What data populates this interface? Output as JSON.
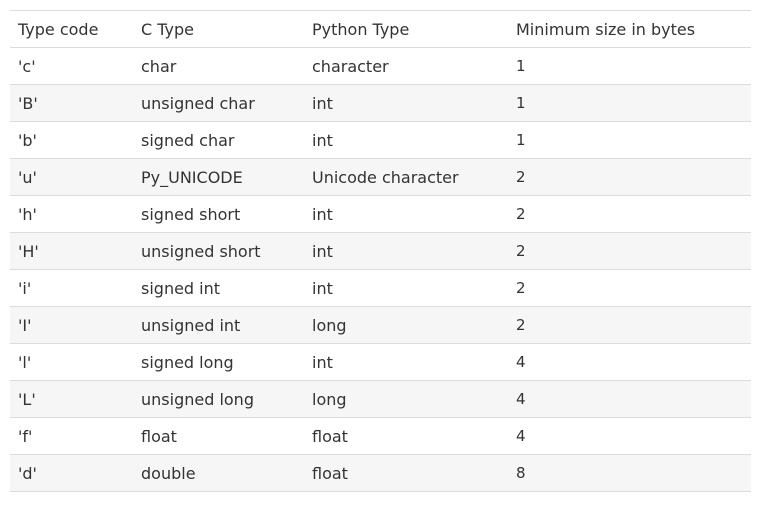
{
  "table": {
    "headers": [
      "Type code",
      "C Type",
      "Python Type",
      "Minimum size in bytes"
    ],
    "rows": [
      [
        "'c'",
        "char",
        "character",
        "1"
      ],
      [
        "'B'",
        "unsigned char",
        "int",
        "1"
      ],
      [
        "'b'",
        "signed char",
        "int",
        "1"
      ],
      [
        "'u'",
        "Py_UNICODE",
        "Unicode character",
        "2"
      ],
      [
        "'h'",
        "signed short",
        "int",
        "2"
      ],
      [
        "'H'",
        "unsigned short",
        "int",
        "2"
      ],
      [
        "'i'",
        "signed int",
        "int",
        "2"
      ],
      [
        "'I'",
        "unsigned int",
        "long",
        "2"
      ],
      [
        "'l'",
        "signed long",
        "int",
        "4"
      ],
      [
        "'L'",
        "unsigned long",
        "long",
        "4"
      ],
      [
        "'f'",
        "float",
        "float",
        "4"
      ],
      [
        "'d'",
        "double",
        "float",
        "8"
      ]
    ]
  }
}
